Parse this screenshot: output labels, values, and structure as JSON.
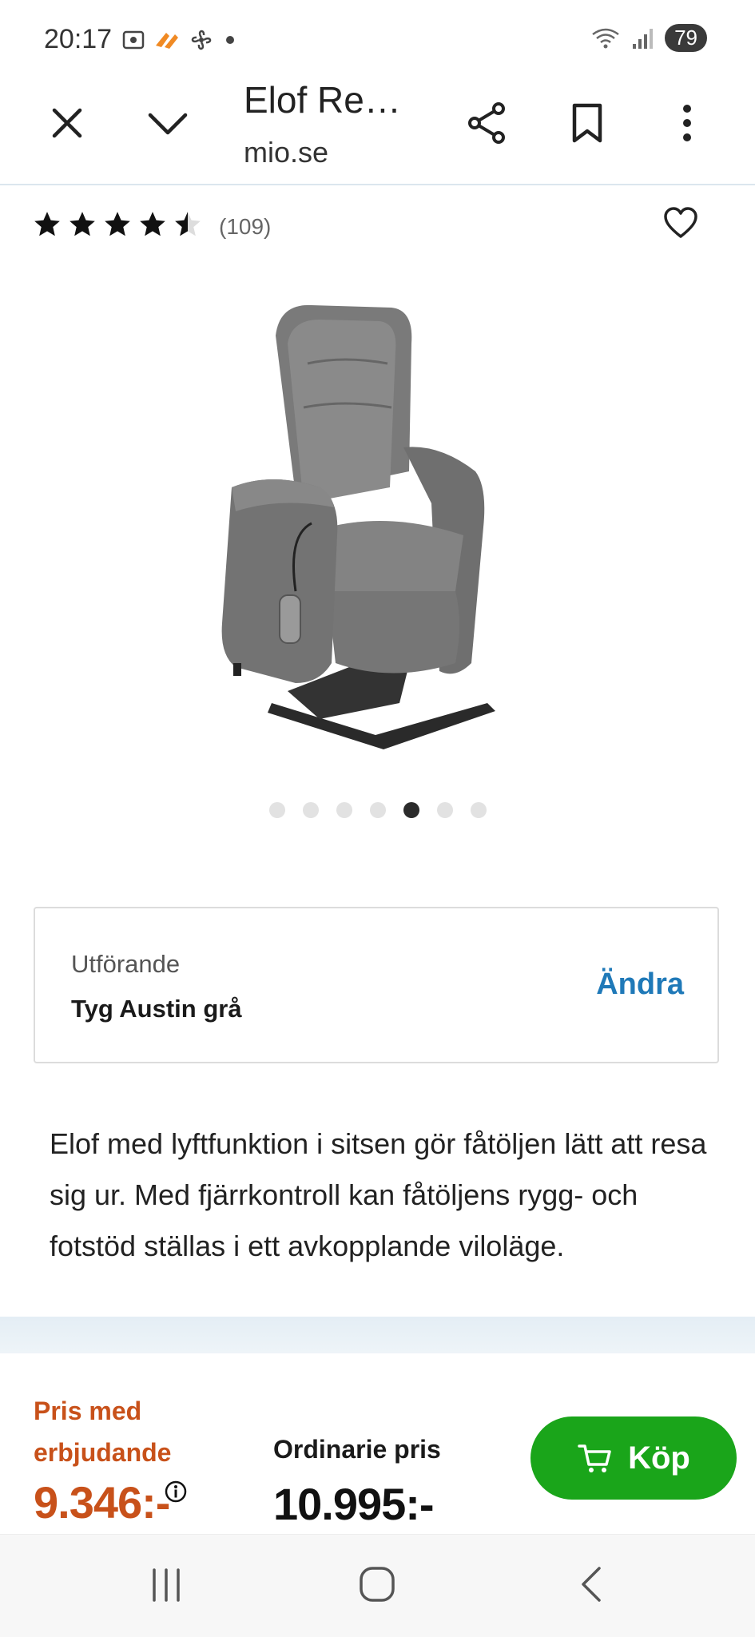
{
  "status_bar": {
    "time": "20:17",
    "battery": "79"
  },
  "toolbar": {
    "title": "Elof Re…",
    "domain": "mio.se",
    "icons": [
      "close-icon",
      "chevron-down-icon",
      "share-icon",
      "bookmark-icon",
      "more-vert-icon"
    ]
  },
  "product": {
    "rating": 4.5,
    "reviews": "(109)",
    "image_count": 7,
    "active_image_index": 4
  },
  "variant": {
    "label": "Utförande",
    "value": "Tyg Austin grå",
    "change": "Ändra"
  },
  "description": "Elof med lyftfunktion i sitsen gör fåtöljen lätt att resa sig ur. Med fjärrkontroll kan fåtöljens rygg- och fotstöd ställas i ett avkopplande viloläge.",
  "pricing": {
    "offer_label_line1": "Pris med",
    "offer_label_line2": "erbjudande",
    "offer_price": "9.346:-",
    "ordinary_label": "Ordinarie pris",
    "ordinary_price": "10.995:-",
    "buy_label": "Köp"
  },
  "colors": {
    "accent_blue": "#1f79b8",
    "offer_orange": "#c8511a",
    "buy_green": "#1aa51a"
  }
}
